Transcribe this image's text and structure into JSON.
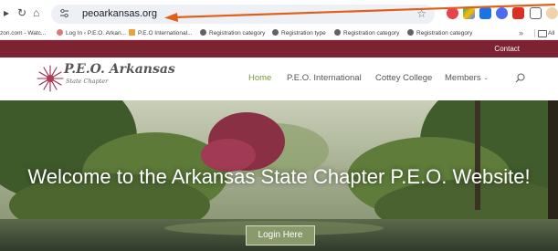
{
  "browser": {
    "url": "peoarkansas.org",
    "nav": {
      "back_icon": "back-arrow-icon",
      "reload_icon": "reload-icon",
      "home_icon": "home-icon"
    },
    "bookmarks": [
      "zon.com - Watc...",
      "Log In ‹ P.E.O. Arkan...",
      "P.E.O International...",
      "Registration category",
      "Registration type",
      "Registration category",
      "Registration category"
    ],
    "bookmarks_overflow": "»",
    "all_bookmarks": "All"
  },
  "site": {
    "contact": "Contact",
    "logo": {
      "title": "P.E.O. Arkansas",
      "subtitle": "State Chapter"
    },
    "menu": [
      "Home",
      "P.E.O. International",
      "Cottey College",
      "Members"
    ],
    "active_menu": "Home",
    "hero_title": "Welcome to the Arkansas State Chapter P.E.O. Website!",
    "login_button": "Login Here"
  },
  "colors": {
    "brand_maroon": "#7c2233",
    "menu_active": "#7a9a3c",
    "login_button": "#8a9a6a",
    "annotation_arrow": "#e0601a"
  }
}
